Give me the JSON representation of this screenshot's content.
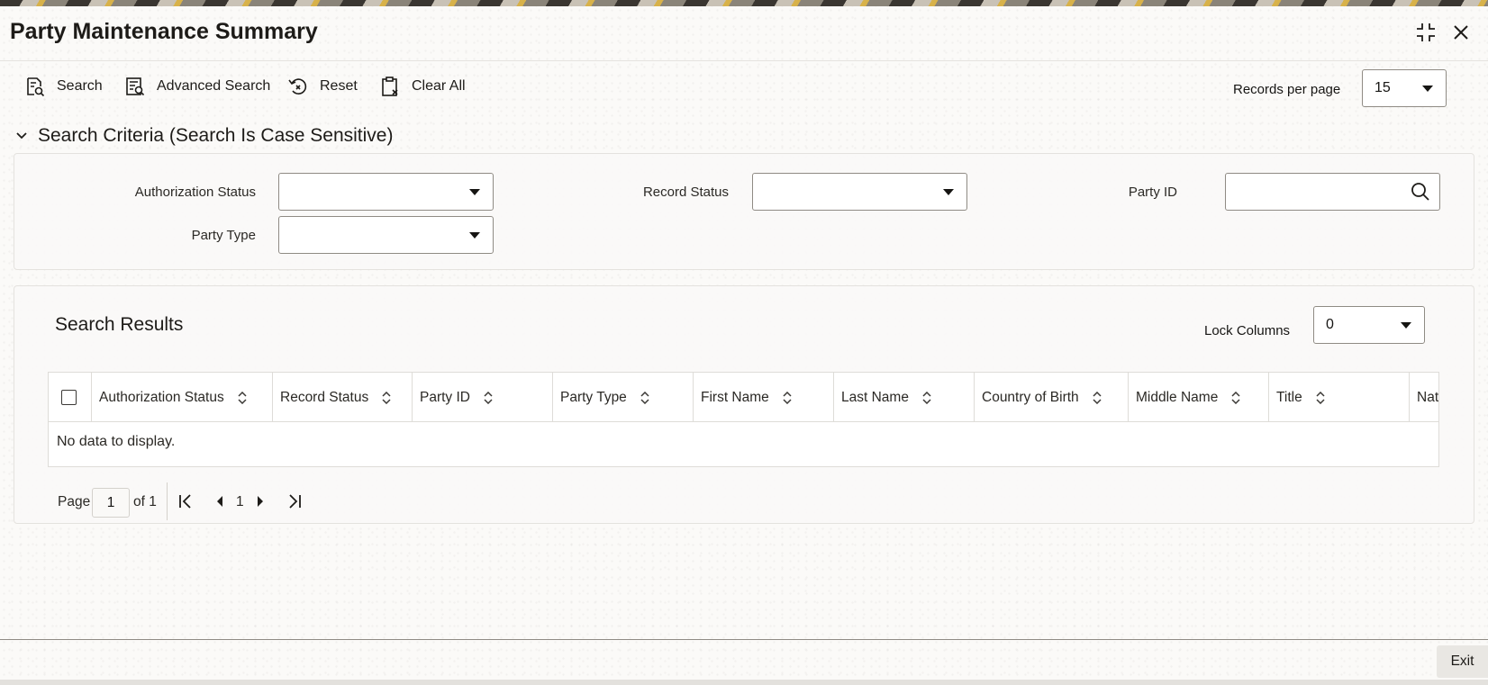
{
  "window": {
    "title": "Party Maintenance Summary"
  },
  "window_controls": {
    "restore_icon": "compress-icon",
    "close_icon": "close-icon"
  },
  "toolbar": {
    "search_label": "Search",
    "advanced_search_label": "Advanced Search",
    "reset_label": "Reset",
    "clear_all_label": "Clear All",
    "records_per_page_label": "Records per page",
    "records_per_page_value": "15"
  },
  "search_criteria": {
    "title": "Search Criteria (Search Is Case Sensitive)",
    "fields": {
      "authorization_status": {
        "label": "Authorization Status",
        "value": ""
      },
      "record_status": {
        "label": "Record Status",
        "value": ""
      },
      "party_id": {
        "label": "Party ID",
        "value": ""
      },
      "party_type": {
        "label": "Party Type",
        "value": ""
      }
    }
  },
  "results": {
    "title": "Search Results",
    "lock_columns_label": "Lock Columns",
    "lock_columns_value": "0",
    "columns": [
      "Authorization Status",
      "Record Status",
      "Party ID",
      "Party Type",
      "First Name",
      "Last Name",
      "Country of Birth",
      "Middle Name",
      "Title",
      "Nati"
    ],
    "empty_message": "No data to display."
  },
  "pagination": {
    "page_label": "Page",
    "page_value": "1",
    "of_label": "of 1",
    "current_page": "1"
  },
  "footer": {
    "exit_label": "Exit"
  },
  "colors": {
    "border": "#8f8b84",
    "text": "#161513",
    "panel": "#faf9f7"
  }
}
